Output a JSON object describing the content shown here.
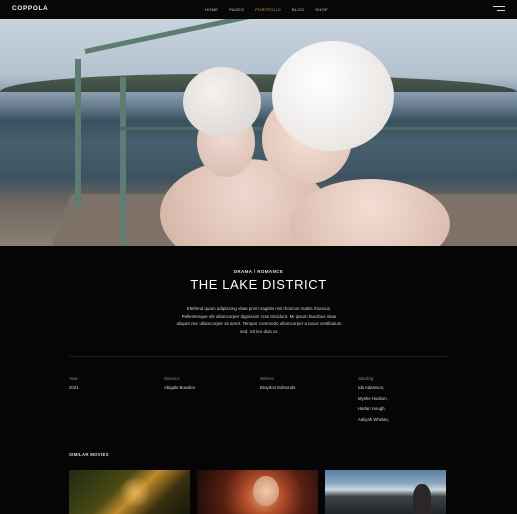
{
  "header": {
    "logo": "COPPOLA",
    "nav": [
      "HOME",
      "PAGES",
      "PORTFOLIO",
      "BLOG",
      "SHOP"
    ],
    "active_nav": "PORTFOLIO",
    "accent_color": "#d9a35a"
  },
  "hero": {
    "image": "two-women-swim-caps-on-dock"
  },
  "movie": {
    "genre": "DRAMA / ROMANCE",
    "title": "THE LAKE DISTRICT",
    "description": "Eleifend quam adipiscing vitae proin sagittis nisl rhoncus mattis rhoncus. Pellentesque elit ullamcorper dignissim cras tincidunt. Mi ipsum faucibus vitae aliquet nec ullamcorper sit amet. Tempor commodo ullamcorper a lacus vestibulum sed. Sit leo duis ut."
  },
  "credits": {
    "year": {
      "label": "Year:",
      "value": "2021"
    },
    "director": {
      "label": "Director:",
      "value": "Abigale Bowden"
    },
    "writers": {
      "label": "Writers:",
      "value": "Braydon Edmonds"
    },
    "starring": {
      "label": "Starring:",
      "values": [
        "Ida Adamson,",
        "Myshe Hodson,",
        "Harlan Hough,",
        "Aaliyah Whelan,"
      ]
    }
  },
  "similar": {
    "heading": "SIMILAR MOVIES",
    "thumbnails": [
      "movie-thumb-car-night",
      "movie-thumb-redhead-woman",
      "movie-thumb-man-by-sea"
    ]
  }
}
